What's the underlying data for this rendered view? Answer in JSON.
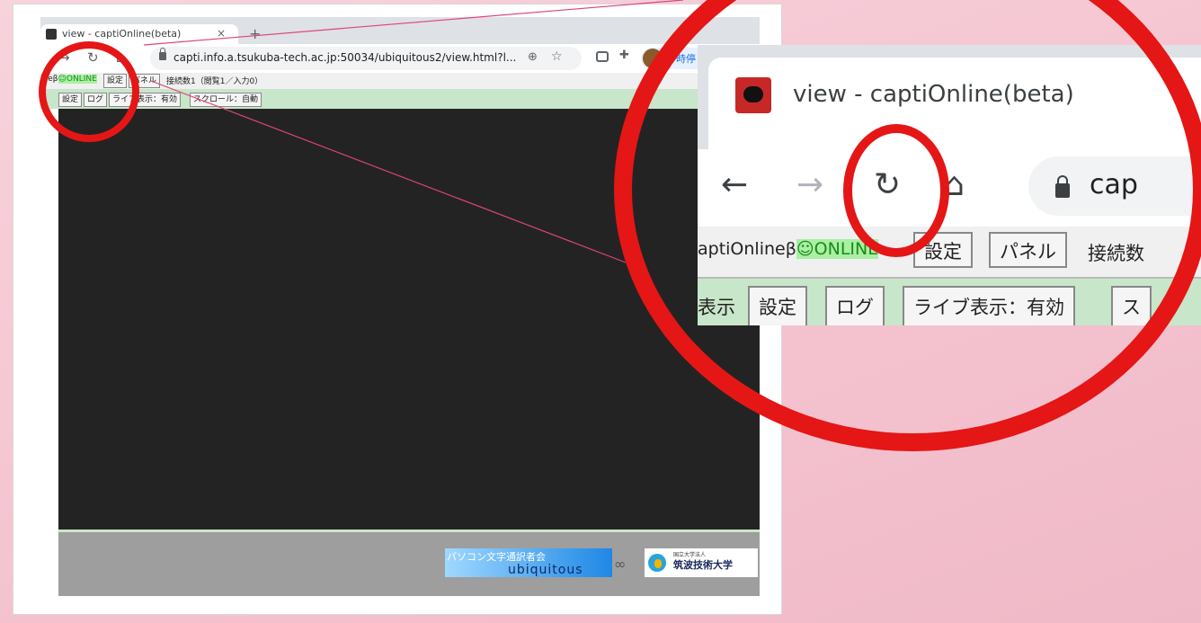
{
  "colors": {
    "accent_red": "#e51616",
    "leader_line": "#e0427a",
    "online_green": "#a9f0a3",
    "viewer_bg": "#232323"
  },
  "browser": {
    "tab_title": "view - captiOnline(beta)",
    "new_tab_icon": "plus-icon",
    "url": "capti.info.a.tsukuba-tech.ac.jp:50034/ubiquitous2/view.html?l...",
    "profile_label": "一時停"
  },
  "app": {
    "online_prefix": "ineβ",
    "online_status": "☺ONLINE",
    "settings_btn": "設定",
    "panel_btn": "パネル",
    "connection_info": "接続数1（閲覧1／入力0）",
    "tab_settings": "設定",
    "tab_log": "ログ",
    "tab_live": "ライブ表示：有効",
    "tab_scroll": "スクロール：自動"
  },
  "footer": {
    "banner_line1": "パソコン文字通訳者会",
    "banner_line2": "ubiquitous",
    "univ_small": "国立大学法人",
    "univ_name": "筑波技術大学"
  },
  "zoom": {
    "tab_title": "view - captiOnline(beta)",
    "url_fragment": "cap",
    "online_prefix": "aptiOnlineβ",
    "online_status": "☺ONLINE",
    "settings_btn": "設定",
    "panel_btn": "パネル",
    "connection_info": "接続数",
    "display_label": "表示",
    "tab_settings": "設定",
    "tab_log": "ログ",
    "tab_live": "ライブ表示：有効",
    "tab_scroll": "ス"
  }
}
